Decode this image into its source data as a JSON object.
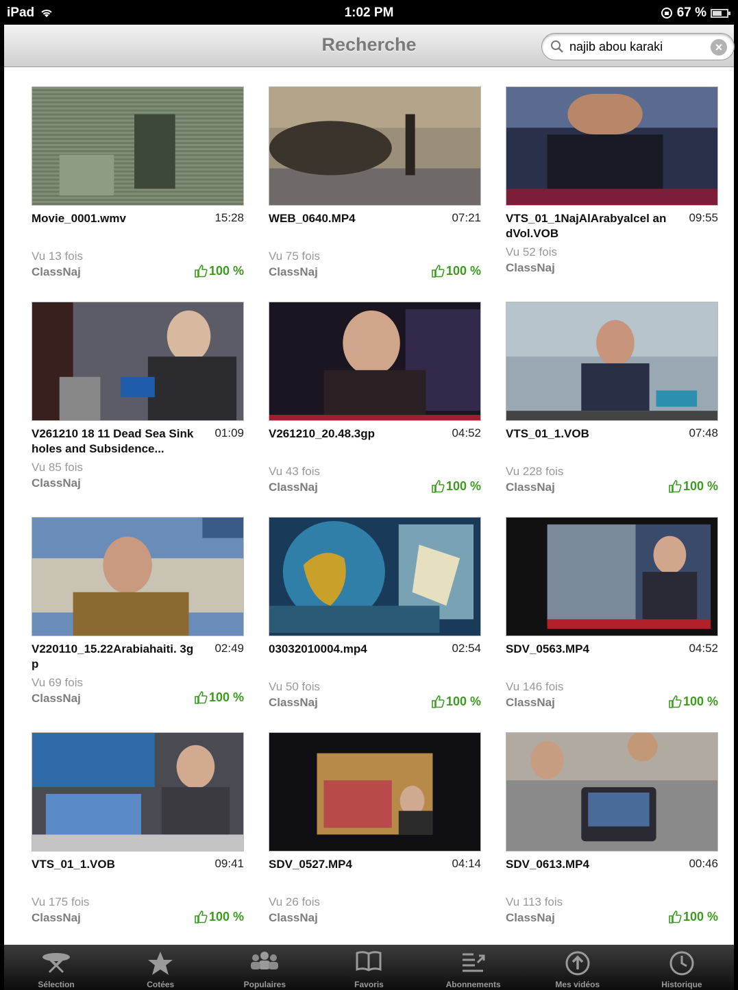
{
  "status_bar": {
    "device": "iPad",
    "time": "1:02 PM",
    "battery": "67 %",
    "battery_level": 0.67
  },
  "nav_bar": {
    "title": "Recherche"
  },
  "search": {
    "value": "najib abou karaki"
  },
  "videos": [
    {
      "title": "Movie_0001.wmv",
      "duration": "15:28",
      "views": "Vu 13 fois",
      "channel": "ClassNaj",
      "rating": "100 %"
    },
    {
      "title": "WEB_0640.MP4",
      "duration": "07:21",
      "views": "Vu 75 fois",
      "channel": "ClassNaj",
      "rating": "100 %"
    },
    {
      "title": "VTS_01_1NajAlArabyalcel andVol.VOB",
      "duration": "09:55",
      "views": "Vu 52 fois",
      "channel": "ClassNaj",
      "rating": ""
    },
    {
      "title": "V261210 18 11 Dead Sea Sinkholes and Subsidence...",
      "duration": "01:09",
      "views": "Vu 85 fois",
      "channel": "ClassNaj",
      "rating": ""
    },
    {
      "title": "V261210_20.48.3gp",
      "duration": "04:52",
      "views": "Vu 43 fois",
      "channel": "ClassNaj",
      "rating": "100 %"
    },
    {
      "title": "VTS_01_1.VOB",
      "duration": "07:48",
      "views": "Vu 228 fois",
      "channel": "ClassNaj",
      "rating": "100 %"
    },
    {
      "title": "V220110_15.22Arabiahaiti. 3gp",
      "duration": "02:49",
      "views": "Vu 69 fois",
      "channel": "ClassNaj",
      "rating": "100 %"
    },
    {
      "title": "03032010004.mp4",
      "duration": "02:54",
      "views": "Vu 50 fois",
      "channel": "ClassNaj",
      "rating": "100 %"
    },
    {
      "title": "SDV_0563.MP4",
      "duration": "04:52",
      "views": "Vu 146 fois",
      "channel": "ClassNaj",
      "rating": "100 %"
    },
    {
      "title": "VTS_01_1.VOB",
      "duration": "09:41",
      "views": "Vu 175 fois",
      "channel": "ClassNaj",
      "rating": "100 %"
    },
    {
      "title": "SDV_0527.MP4",
      "duration": "04:14",
      "views": "Vu 26 fois",
      "channel": "ClassNaj",
      "rating": ""
    },
    {
      "title": "SDV_0613.MP4",
      "duration": "00:46",
      "views": "Vu 113 fois",
      "channel": "ClassNaj",
      "rating": "100 %"
    }
  ],
  "tab_bar": {
    "items": [
      {
        "label": "Sélection",
        "icon": "satellite-icon"
      },
      {
        "label": "Cotées",
        "icon": "star-icon"
      },
      {
        "label": "Populaires",
        "icon": "people-icon"
      },
      {
        "label": "Favoris",
        "icon": "book-icon"
      },
      {
        "label": "Abonnements",
        "icon": "subscriptions-icon"
      },
      {
        "label": "Mes vidéos",
        "icon": "upload-icon"
      },
      {
        "label": "Historique",
        "icon": "clock-icon"
      }
    ]
  },
  "colors": {
    "rating_green": "#3b9b1f",
    "views_gray": "#999999"
  }
}
